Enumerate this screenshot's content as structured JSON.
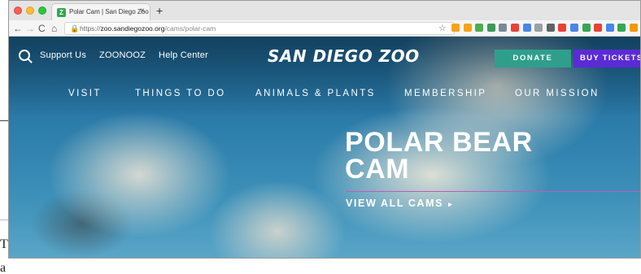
{
  "browser": {
    "tab_title": "Polar Cam | San Diego Zoo",
    "tab_favicon": "Z",
    "tab_close": "×",
    "new_tab": "+",
    "url_scheme": "https://",
    "url_domain": "zoo.sandiegozoo.org",
    "url_path": "/cams/polar-cam",
    "lock": "🔒",
    "star": "☆",
    "nav_back": "←",
    "nav_forward": "→",
    "nav_reload": "C",
    "nav_home": "⌂",
    "extension_colors": [
      "#f4a21b",
      "#f4a21b",
      "#4caf50",
      "#3d9a5b",
      "#7b8a99",
      "#e94235",
      "#4a86e8",
      "#9aa0a6",
      "#5f6368",
      "#e94235",
      "#4a86e8",
      "#34a853",
      "#e94235",
      "#4a86e8",
      "#34a853",
      "#f29900"
    ]
  },
  "site": {
    "utility_nav": [
      "Support Us",
      "ZOONOOZ",
      "Help Center"
    ],
    "logo": "SAN DIEGO ZOO",
    "donate_label": "DONATE",
    "tickets_label": "BUY TICKETS",
    "main_nav": [
      "VISIT",
      "THINGS TO DO",
      "ANIMALS & PLANTS",
      "MEMBERSHIP",
      "OUR MISSION"
    ],
    "hero_title_line1": "POLAR BEAR",
    "hero_title_line2": "CAM",
    "hero_link": "VIEW ALL CAMS",
    "hero_link_arrow": "▸"
  },
  "background_doc": {
    "line1": "Th",
    "line2": "a"
  },
  "colors": {
    "donate": "#2f9f8c",
    "tickets": "#5b2bd6",
    "hero_rule": "#c45ab8"
  }
}
